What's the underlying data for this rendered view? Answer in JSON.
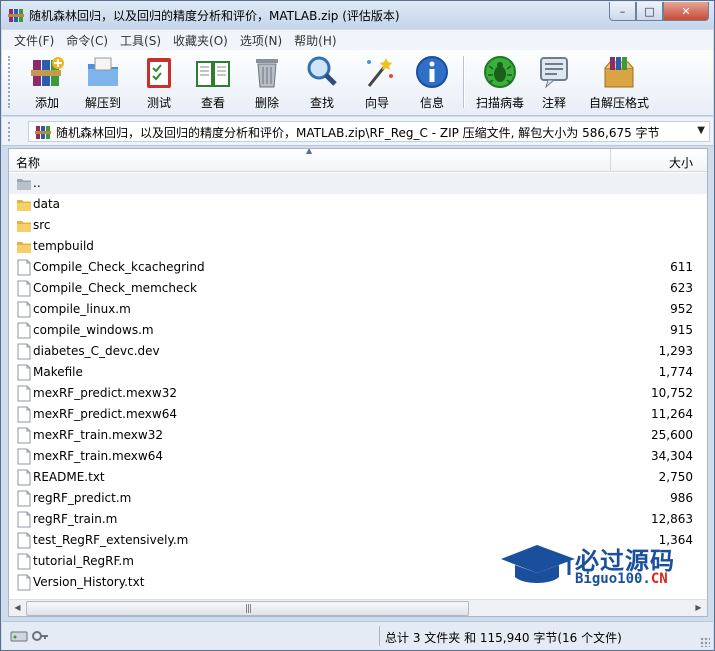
{
  "window": {
    "title": "随机森林回归，以及回归的精度分析和评价，MATLAB.zip (评估版本)",
    "controls": {
      "minimize": "–",
      "maximize": "□",
      "close": "✕"
    }
  },
  "menu": [
    "文件(F)",
    "命令(C)",
    "工具(S)",
    "收藏夹(O)",
    "选项(N)",
    "帮助(H)"
  ],
  "toolbar": [
    {
      "label": "添加",
      "icon": "add-archive-icon"
    },
    {
      "label": "解压到",
      "icon": "extract-to-icon"
    },
    {
      "label": "测试",
      "icon": "test-icon"
    },
    {
      "label": "查看",
      "icon": "view-icon"
    },
    {
      "label": "删除",
      "icon": "delete-icon"
    },
    {
      "label": "查找",
      "icon": "find-icon"
    },
    {
      "label": "向导",
      "icon": "wizard-icon"
    },
    {
      "label": "信息",
      "icon": "info-icon"
    },
    {
      "label": "扫描病毒",
      "icon": "virus-scan-icon"
    },
    {
      "label": "注释",
      "icon": "comment-icon"
    },
    {
      "label": "自解压格式",
      "icon": "sfx-icon"
    }
  ],
  "address": {
    "path": "随机森林回归，以及回归的精度分析和评价，MATLAB.zip\\RF_Reg_C - ZIP 压缩文件, 解包大小为 586,675 字节"
  },
  "list": {
    "columns": {
      "name": "名称",
      "size": "大小"
    },
    "rows": [
      {
        "name": "..",
        "size": "",
        "type": "parent"
      },
      {
        "name": "data",
        "size": "",
        "type": "folder"
      },
      {
        "name": "src",
        "size": "",
        "type": "folder"
      },
      {
        "name": "tempbuild",
        "size": "",
        "type": "folder"
      },
      {
        "name": "Compile_Check_kcachegrind",
        "size": "611",
        "type": "file"
      },
      {
        "name": "Compile_Check_memcheck",
        "size": "623",
        "type": "file"
      },
      {
        "name": "compile_linux.m",
        "size": "952",
        "type": "file"
      },
      {
        "name": "compile_windows.m",
        "size": "915",
        "type": "file"
      },
      {
        "name": "diabetes_C_devc.dev",
        "size": "1,293",
        "type": "file"
      },
      {
        "name": "Makefile",
        "size": "1,774",
        "type": "file"
      },
      {
        "name": "mexRF_predict.mexw32",
        "size": "10,752",
        "type": "file"
      },
      {
        "name": "mexRF_predict.mexw64",
        "size": "11,264",
        "type": "file"
      },
      {
        "name": "mexRF_train.mexw32",
        "size": "25,600",
        "type": "file"
      },
      {
        "name": "mexRF_train.mexw64",
        "size": "34,304",
        "type": "file"
      },
      {
        "name": "README.txt",
        "size": "2,750",
        "type": "file"
      },
      {
        "name": "regRF_predict.m",
        "size": "986",
        "type": "file"
      },
      {
        "name": "regRF_train.m",
        "size": "12,863",
        "type": "file"
      },
      {
        "name": "test_RegRF_extensively.m",
        "size": "1,364",
        "type": "file"
      },
      {
        "name": "tutorial_RegRF.m",
        "size": "",
        "type": "file"
      },
      {
        "name": "Version_History.txt",
        "size": "",
        "type": "file"
      }
    ]
  },
  "status": {
    "summary": "总计 3 文件夹 和 115,940 字节(16 个文件)"
  },
  "watermark": {
    "cn": "必过源码",
    "en": "Biguo100.",
    "en_suffix": "CN"
  }
}
